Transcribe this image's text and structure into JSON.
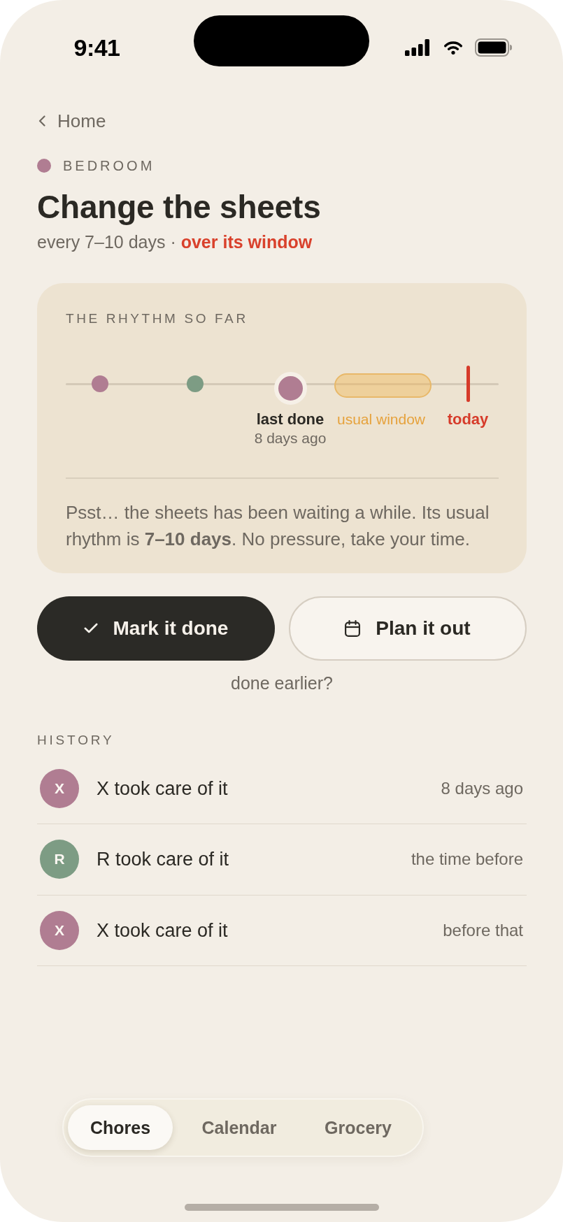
{
  "status_bar": {
    "time": "9:41"
  },
  "nav": {
    "back": "Home"
  },
  "header": {
    "room": {
      "label": "BEDROOM",
      "color": "#b07d92"
    },
    "title": "Change the sheets",
    "frequency": "every 7–10 days",
    "separator": "·",
    "status": "over its window",
    "overdue": true
  },
  "rhythm": {
    "label": "THE RHYTHM SO FAR",
    "timeline": {
      "events": [
        {
          "kind": "done",
          "color": "#b07d92"
        },
        {
          "kind": "done",
          "color": "#7d9c84"
        },
        {
          "kind": "last",
          "color": "#b07d92",
          "label": "last done",
          "sublabel": "8 days ago"
        }
      ],
      "window": {
        "label": "usual window"
      },
      "today": {
        "label": "today"
      }
    },
    "message": "Psst… the sheets has been waiting a while. Its usual rhythm is **7–10 days**. No pressure, take your time."
  },
  "actions": [
    {
      "kind": "primary",
      "label": "Mark it done"
    },
    {
      "kind": "secondary",
      "label": "Plan it out"
    }
  ],
  "done_earlier": "done earlier?",
  "history": {
    "label": "HISTORY",
    "entries": [
      {
        "initial": "X",
        "color": "#b07d92",
        "text": "X took care of it",
        "when": "8 days ago"
      },
      {
        "initial": "R",
        "color": "#7d9c84",
        "text": "R took care of it",
        "when": "the time before"
      },
      {
        "initial": "X",
        "color": "#b07d92",
        "text": "X took care of it",
        "when": "before that"
      }
    ]
  },
  "tab_bar": {
    "tabs": [
      {
        "label": "Chores",
        "selected": true
      },
      {
        "label": "Calendar",
        "selected": false
      },
      {
        "label": "Grocery",
        "selected": false
      }
    ]
  }
}
